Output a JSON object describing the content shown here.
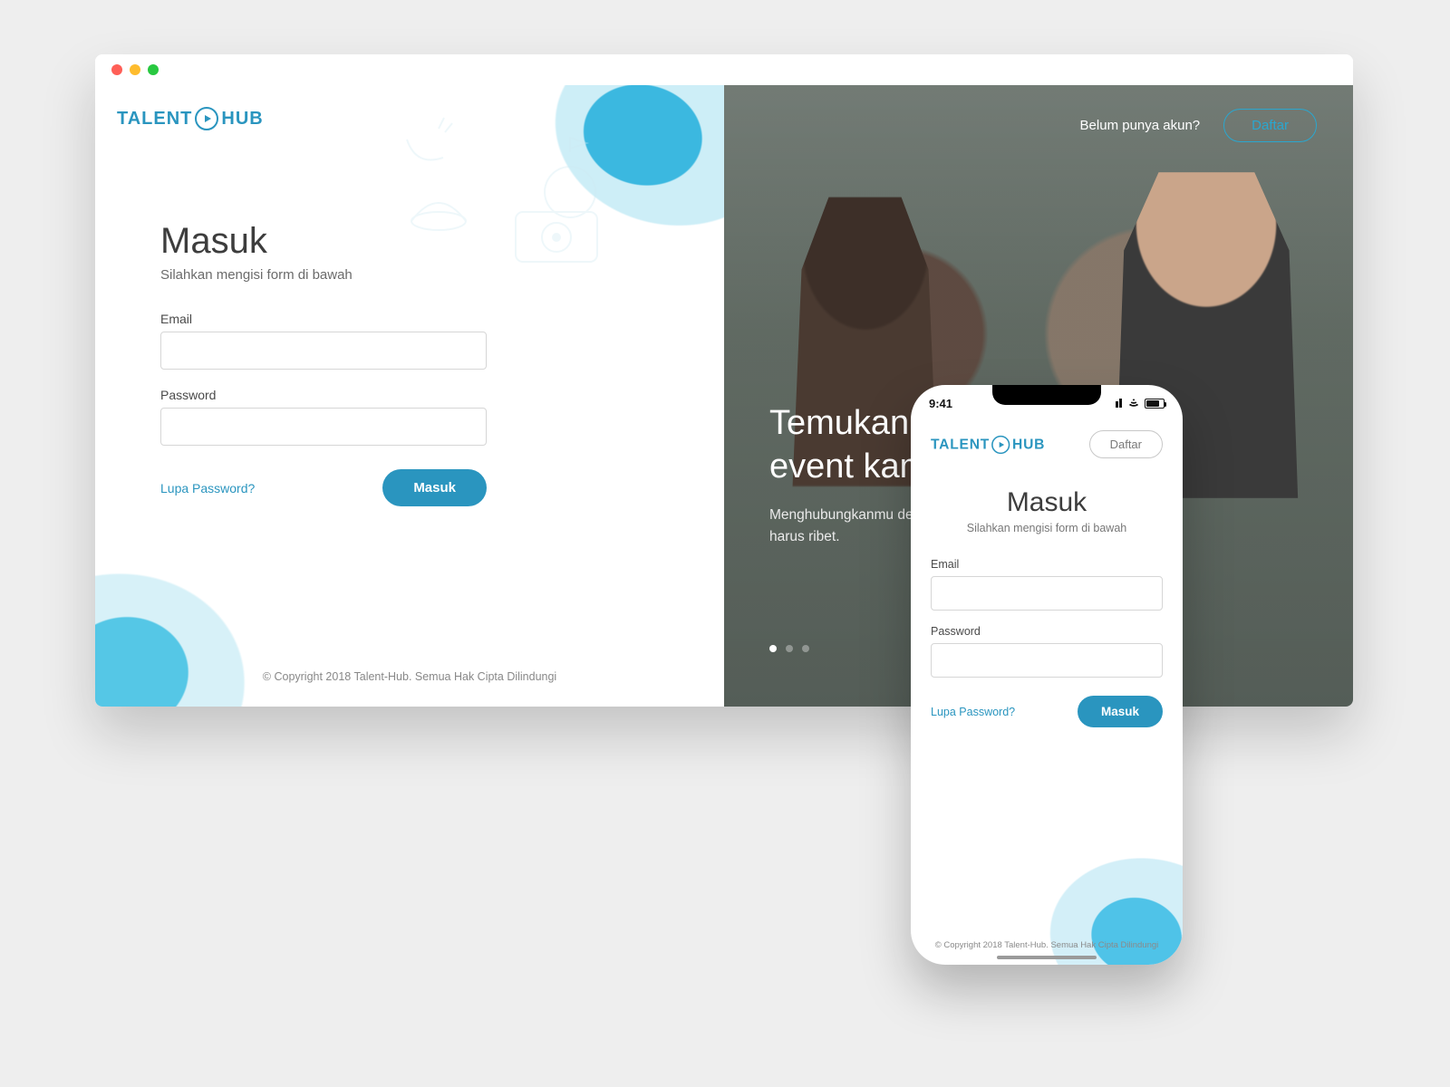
{
  "brand": {
    "part1": "TALENT",
    "part2": "HUB"
  },
  "desktop": {
    "login": {
      "title": "Masuk",
      "subtitle": "Silahkan mengisi form di bawah",
      "email_label": "Email",
      "password_label": "Password",
      "forgot": "Lupa Password?",
      "submit": "Masuk",
      "copyright": "© Copyright 2018 Talent-Hub. Semua Hak Cipta Dilindungi"
    },
    "hero": {
      "prompt": "Belum punya akun?",
      "cta": "Daftar",
      "headline_line1": "Temukan tal",
      "headline_line2": "event kamu ",
      "body": "Menghubungkanmu dengan tale Indonesia tanpa harus ribet.",
      "dots": 3,
      "active_dot": 0
    }
  },
  "mobile": {
    "status_time": "9:41",
    "cta": "Daftar",
    "title": "Masuk",
    "subtitle": "Silahkan mengisi form di bawah",
    "email_label": "Email",
    "password_label": "Password",
    "forgot": "Lupa Password?",
    "submit": "Masuk",
    "copyright": "© Copyright 2018 Talent-Hub. Semua Hak Cipta Dilindungi"
  }
}
